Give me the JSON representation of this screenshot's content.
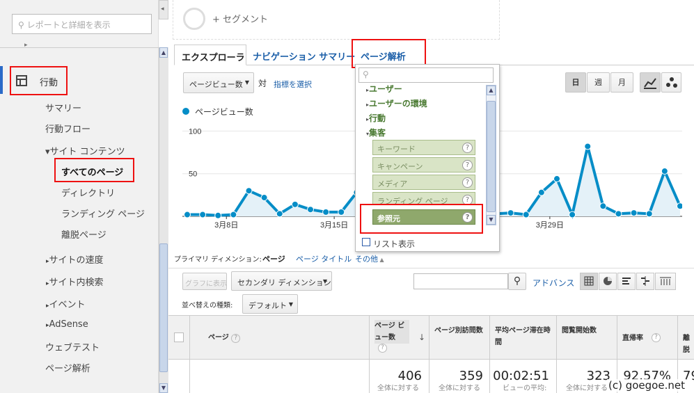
{
  "sidebar": {
    "search_placeholder": "レポートと詳細を表示",
    "behavior": "行動",
    "summary": "サマリー",
    "flow": "行動フロー",
    "site_content": "▾サイト コンテンツ",
    "all_pages": "すべてのページ",
    "directory": "ディレクトリ",
    "landing": "ランディング ページ",
    "exit": "離脱ページ",
    "site_speed": "サイトの速度",
    "site_search": "サイト内検索",
    "events": "イベント",
    "adsense": "AdSense",
    "webtest": "ウェブテスト",
    "page_analysis": "ページ解析"
  },
  "segment": {
    "label": "+ セグメント"
  },
  "tabs": {
    "explorer": "エクスプローラ",
    "nav_summary": "ナビゲーション サマリー",
    "page_analysis": "ページ解析"
  },
  "controls": {
    "metric": "ページビュー数",
    "vs": "対",
    "select_metric": "指標を選択",
    "day": "日",
    "week": "週",
    "month": "月"
  },
  "chart_data": {
    "type": "area",
    "legend": "ページビュー数",
    "y_ticks": [
      "100",
      "50"
    ],
    "x_labels": [
      "3月8日",
      "3月15日",
      "3月29日"
    ],
    "ylim": [
      0,
      115
    ],
    "values": [
      2,
      2,
      1,
      2,
      30,
      22,
      3,
      14,
      8,
      5,
      5,
      28,
      12,
      10,
      8,
      5,
      6,
      4,
      4,
      3,
      3,
      4,
      2,
      28,
      44,
      2,
      82,
      12,
      3,
      4,
      3,
      53,
      12
    ],
    "color": "#058dc7"
  },
  "dropdown": {
    "categories": [
      "ユーザー",
      "ユーザーの環境",
      "行動",
      "集客"
    ],
    "options": [
      "キーワード",
      "キャンペーン",
      "メディア",
      "ランディング ページ"
    ],
    "selected": "参照元",
    "list_view": "リスト表示"
  },
  "dimension": {
    "label": "プライマリ ディメンション:",
    "current": "ページ",
    "page_title": "ページ タイトル",
    "other": "その他"
  },
  "toolbar": {
    "graph_btn": "グラフに表示",
    "secondary": "セカンダリ ディメンション",
    "advanced": "アドバンス",
    "sort_label": "並べ替えの種類:",
    "sort_value": "デフォルト"
  },
  "table": {
    "col_page": "ページ",
    "col_pv": "ページ ビュー数",
    "col_upv": "ページ別訪問数",
    "col_time": "平均ページ滞在時間",
    "col_entr": "閲覧開始数",
    "col_bounce": "直帰率",
    "col_exit": "離脱",
    "pv": "406",
    "upv": "359",
    "time": "00:02:51",
    "entr": "323",
    "bounce": "92.57%",
    "exit": "79",
    "pv_sub": "全体に対する",
    "upv_sub": "全体に対する",
    "time_sub": "ビューの平均:",
    "entr_sub": "全体に対する"
  },
  "watermark": "(c) goegoe.net"
}
